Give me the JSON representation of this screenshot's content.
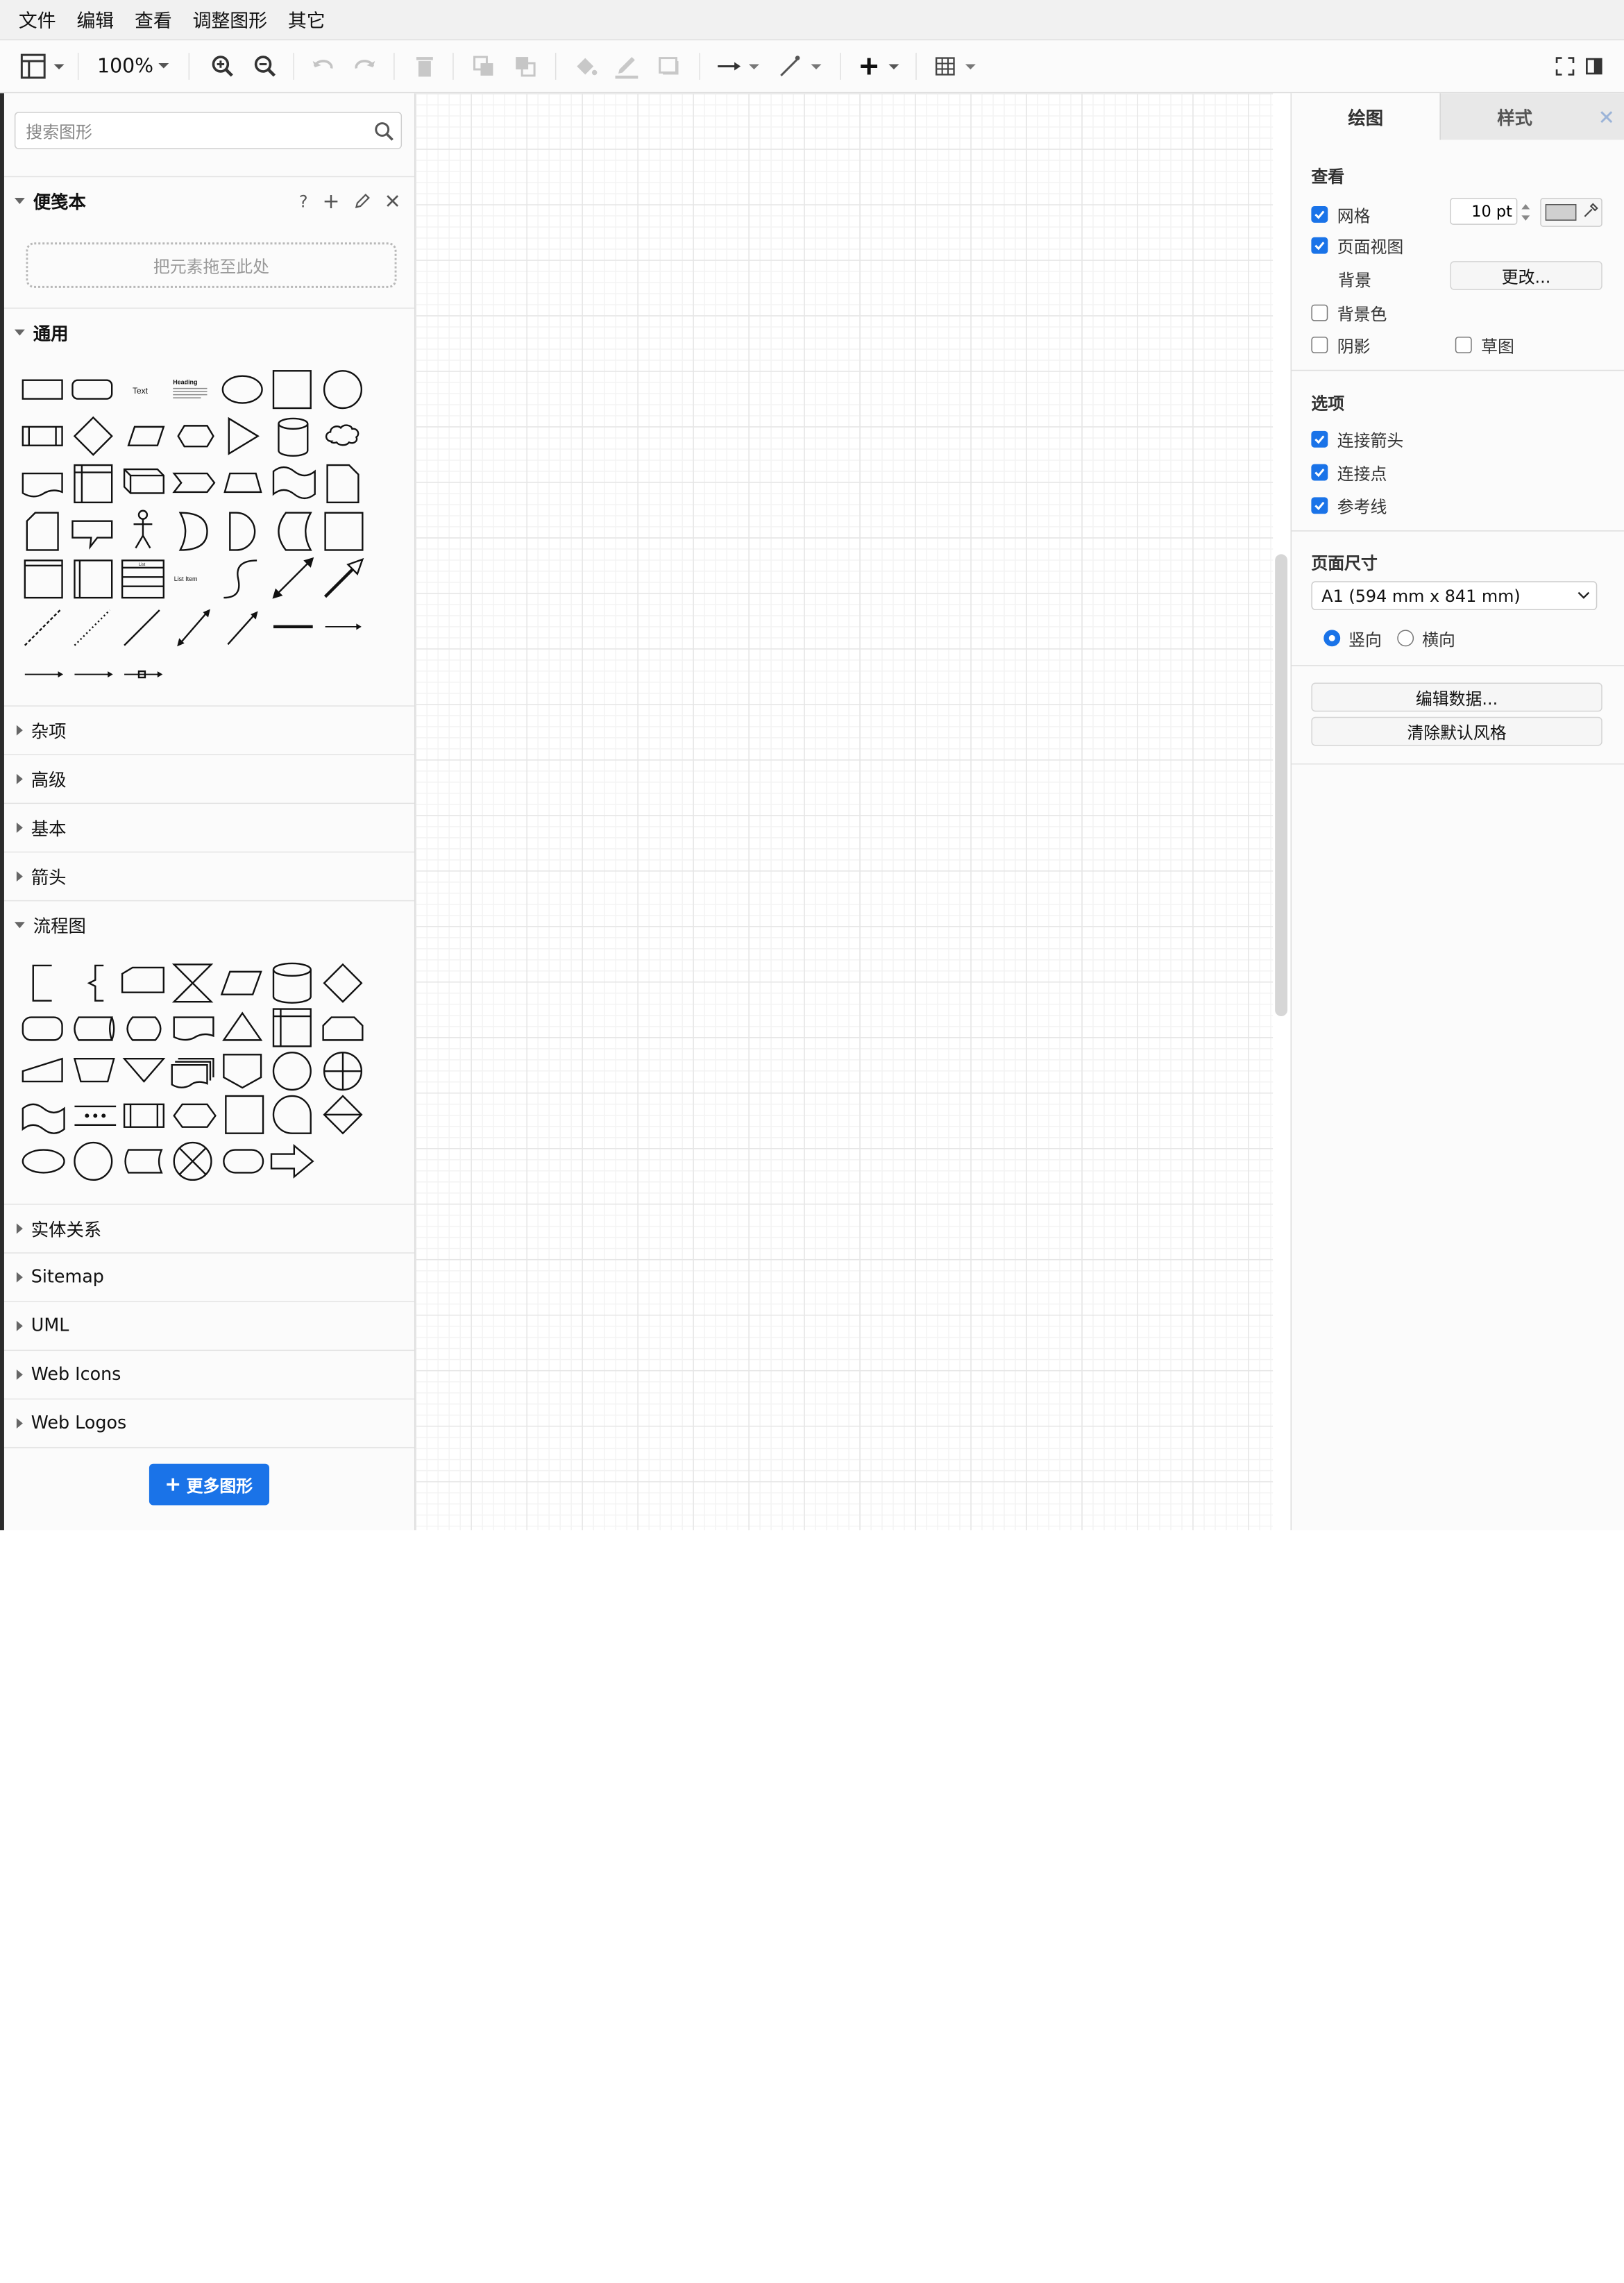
{
  "menu": [
    "文件",
    "编辑",
    "查看",
    "调整图形",
    "其它"
  ],
  "toolbar": {
    "zoom": "100%"
  },
  "icons": {
    "layout": "panel-layout-icon",
    "zoom_in": "zoom-in-icon",
    "zoom_out": "zoom-out-icon",
    "undo": "undo-icon",
    "redo": "redo-icon",
    "delete": "trash-icon",
    "to_front": "to-front-icon",
    "to_back": "to-back-icon",
    "fill": "fill-bucket-icon",
    "line": "line-color-icon",
    "shadow": "shadow-icon",
    "connection": "connection-arrow-icon",
    "waypoints": "waypoints-icon",
    "insert": "plus-icon",
    "table": "table-icon",
    "fullscreen": "fullscreen-icon",
    "format_panel": "format-panel-icon",
    "search": "search-icon"
  },
  "sidebar": {
    "search_placeholder": "搜索图形",
    "scratchpad": {
      "title": "便笺本",
      "help": "?",
      "add": "+",
      "drop_hint": "把元素拖至此处"
    },
    "general": {
      "title": "通用",
      "text_shape": "Text",
      "heading_shape": "Heading",
      "list_shape": "List",
      "list_item_shape": "List Item"
    },
    "collapsed_a": [
      "杂项",
      "高级",
      "基本",
      "箭头"
    ],
    "flowchart": {
      "title": "流程图"
    },
    "collapsed_b": [
      "实体关系",
      "Sitemap",
      "UML",
      "Web Icons",
      "Web Logos"
    ],
    "more_shapes": "更多图形"
  },
  "format_panel": {
    "tabs": [
      "绘图",
      "样式"
    ],
    "view": {
      "title": "查看",
      "grid": "网格",
      "grid_size": "10 pt",
      "page_view": "页面视图",
      "background": "背景",
      "change": "更改...",
      "background_color": "背景色",
      "shadow": "阴影",
      "sketch": "草图"
    },
    "options": {
      "title": "选项",
      "connection_arrows": "连接箭头",
      "connection_points": "连接点",
      "guides": "参考线"
    },
    "page_size": {
      "title": "页面尺寸",
      "selected": "A1 (594 mm x 841 mm)",
      "portrait": "竖向",
      "landscape": "横向"
    },
    "edit_data": "编辑数据...",
    "clear_default_style": "清除默认风格"
  },
  "colors": {
    "accent": "#1a73e8",
    "grid_major": "#e6e6e6",
    "grid_minor": "#f3f3f3"
  }
}
